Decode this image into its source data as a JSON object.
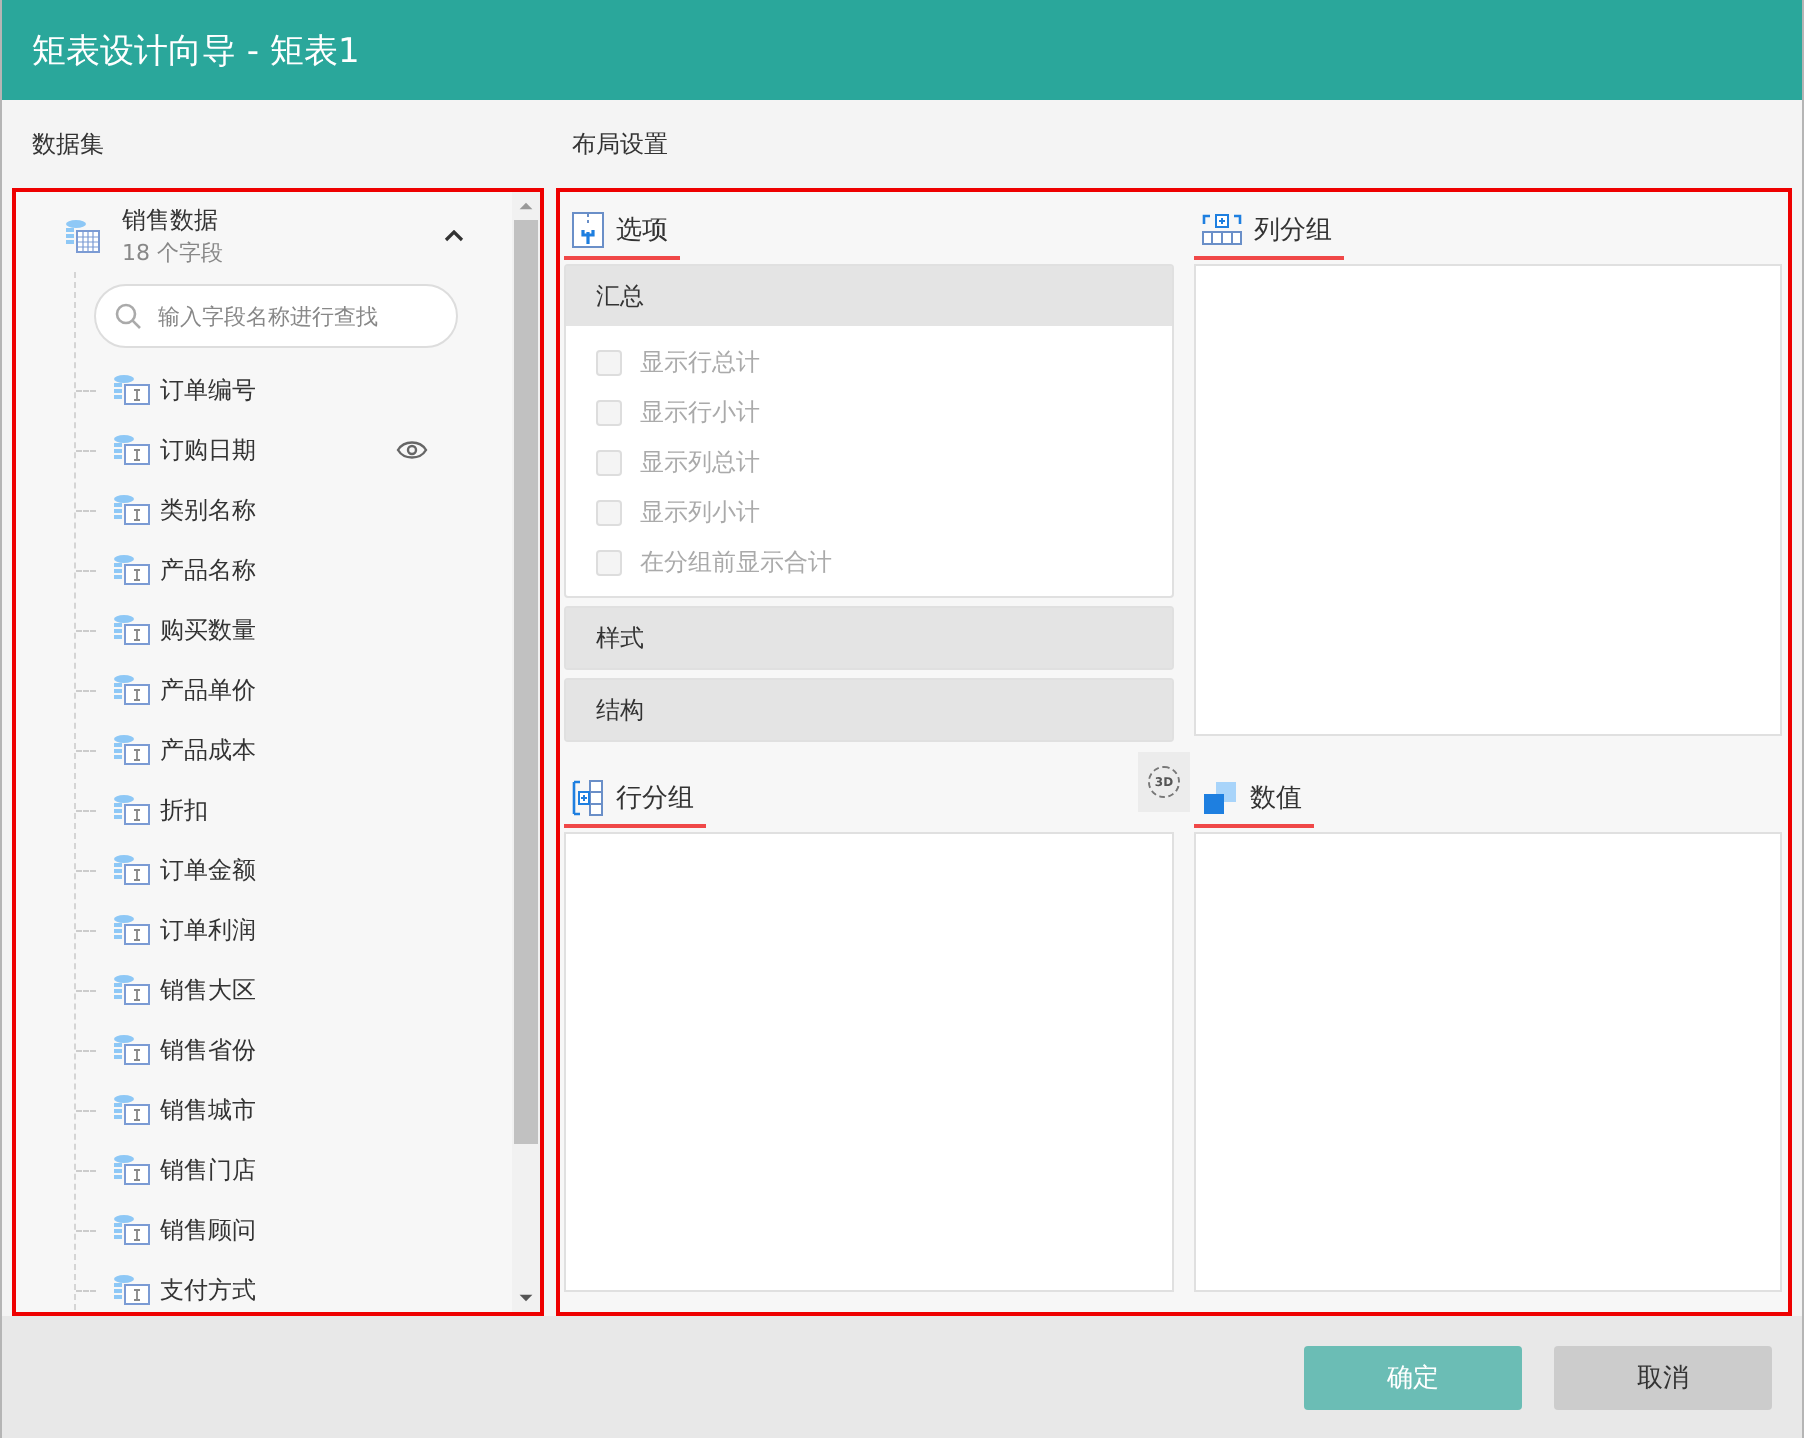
{
  "window": {
    "title": "矩表设计向导 - 矩表1"
  },
  "dataset_panel": {
    "label": "数据集",
    "dataset": {
      "name": "销售数据",
      "count": "18 个字段",
      "expanded": true
    },
    "search": {
      "placeholder": "输入字段名称进行查找"
    },
    "fields": [
      {
        "name": "订单编号",
        "preview": false
      },
      {
        "name": "订购日期",
        "preview": true
      },
      {
        "name": "类别名称",
        "preview": false
      },
      {
        "name": "产品名称",
        "preview": false
      },
      {
        "name": "购买数量",
        "preview": false
      },
      {
        "name": "产品单价",
        "preview": false
      },
      {
        "name": "产品成本",
        "preview": false
      },
      {
        "name": "折扣",
        "preview": false
      },
      {
        "name": "订单金额",
        "preview": false
      },
      {
        "name": "订单利润",
        "preview": false
      },
      {
        "name": "销售大区",
        "preview": false
      },
      {
        "name": "销售省份",
        "preview": false
      },
      {
        "name": "销售城市",
        "preview": false
      },
      {
        "name": "销售门店",
        "preview": false
      },
      {
        "name": "销售顾问",
        "preview": false
      },
      {
        "name": "支付方式",
        "preview": false
      }
    ]
  },
  "layout_panel": {
    "label": "布局设置",
    "options": {
      "title": "选项",
      "sections": [
        {
          "title": "汇总",
          "expanded": true,
          "checkboxes": [
            {
              "label": "显示行总计",
              "checked": false,
              "disabled": true
            },
            {
              "label": "显示行小计",
              "checked": false,
              "disabled": true
            },
            {
              "label": "显示列总计",
              "checked": false,
              "disabled": true
            },
            {
              "label": "显示列小计",
              "checked": false,
              "disabled": true
            },
            {
              "label": "在分组前显示合计",
              "checked": false,
              "disabled": true
            }
          ]
        },
        {
          "title": "样式",
          "expanded": false
        },
        {
          "title": "结构",
          "expanded": false
        }
      ]
    },
    "column_groups": {
      "title": "列分组"
    },
    "row_groups": {
      "title": "行分组",
      "rotate_button": {
        "label": "3D"
      }
    },
    "values": {
      "title": "数值"
    }
  },
  "buttons": [
    {
      "label": "确定",
      "kind": "primary"
    },
    {
      "label": "取消",
      "kind": "secondary"
    }
  ]
}
